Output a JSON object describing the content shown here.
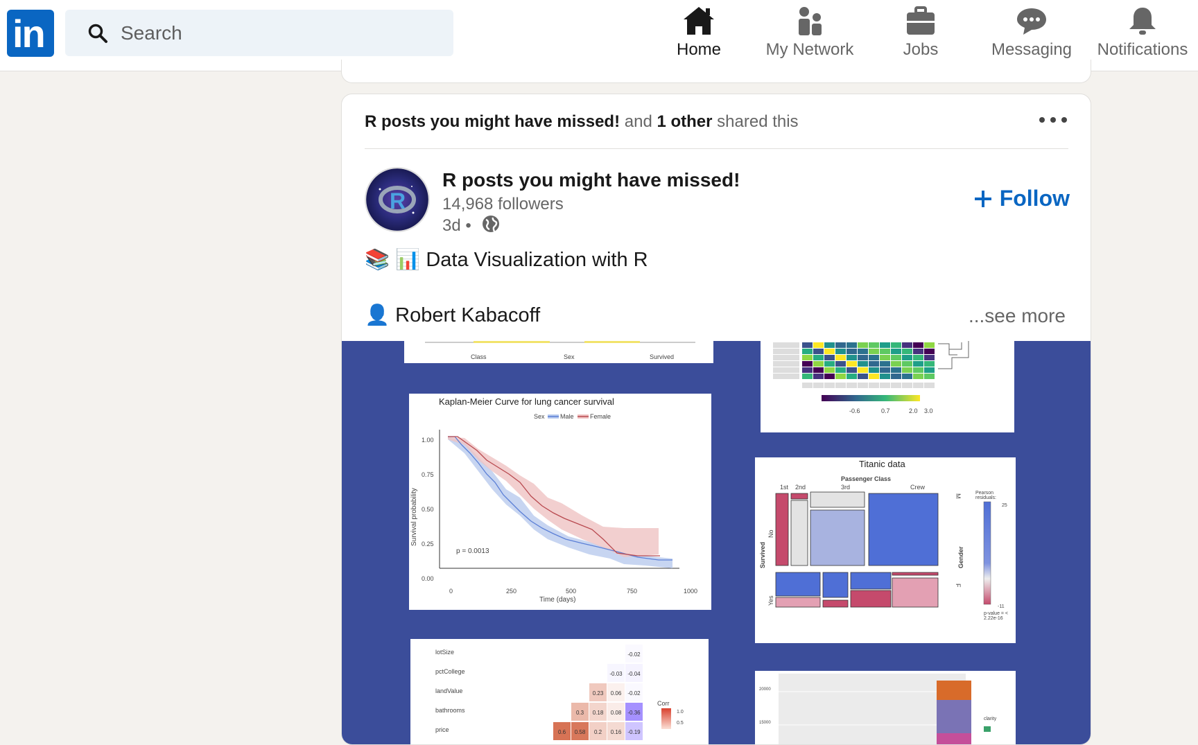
{
  "topbar": {
    "logo_text": "in",
    "search_placeholder": "Search",
    "nav": [
      {
        "label": "Home",
        "icon": "home-icon",
        "active": true
      },
      {
        "label": "My Network",
        "icon": "people-icon",
        "active": false
      },
      {
        "label": "Jobs",
        "icon": "briefcase-icon",
        "active": false
      },
      {
        "label": "Messaging",
        "icon": "chat-icon",
        "active": false
      },
      {
        "label": "Notifications",
        "icon": "bell-icon",
        "active": false
      }
    ]
  },
  "post": {
    "shared_by_1": "R posts you might have missed!",
    "shared_and": " and ",
    "shared_by_2": "1 other",
    "shared_suffix": " shared this",
    "page_name": "R posts you might have missed!",
    "followers": "14,968 followers",
    "time": "3d •",
    "follow_label": "Follow",
    "line1_emoji": "📚 📊",
    "line1_text": "Data Visualization with R",
    "line2_emoji": "👤",
    "line2_text": "Robert Kabacoff",
    "see_more": "...see more"
  },
  "media": {
    "km": {
      "title": "Kaplan-Meier Curve for lung cancer survival",
      "legend_strata": "Sex",
      "legend_male": "Male",
      "legend_female": "Female",
      "ylabel": "Survival probability",
      "xlabel": "Time (days)",
      "pvalue": "p = 0.0013",
      "yticks": [
        "1.00",
        "0.75",
        "0.50",
        "0.25",
        "0.00"
      ],
      "xticks": [
        "0",
        "250",
        "500",
        "750",
        "1000"
      ]
    },
    "titanic": {
      "title": "Titanic data",
      "class_label": "Passenger Class",
      "classes": [
        "1st",
        "2nd",
        "3rd",
        "Crew"
      ],
      "survived_label": "Survived",
      "survived_no": "No",
      "survived_yes": "Yes",
      "gender_label": "Gender",
      "gender_m": "M",
      "gender_f": "F",
      "legend_title": "Pearson residuals:",
      "legend_max": "25",
      "legend_min": "-11",
      "pvalue": "p-value = < 2.22e-16"
    },
    "heatmap": {
      "legend_ticks": [
        "-0.6",
        "0.7",
        "2.0",
        "3.0"
      ]
    },
    "corr": {
      "rows": [
        "lotSize",
        "pctCollege",
        "landValue",
        "bathrooms",
        "price"
      ],
      "values": [
        "-0.02",
        "-0.03",
        "-0.04",
        "0.23",
        "0.06",
        "-0.02",
        "0.3",
        "0.18",
        "0.08",
        "-0.36",
        "0.6",
        "0.58",
        "0.2",
        "0.16",
        "-0.19"
      ],
      "legend_title": "Corr",
      "legend_ticks": [
        "1.0",
        "0.5"
      ]
    },
    "bar": {
      "yticks": [
        "20000",
        "15000"
      ],
      "legend_title": "clarity"
    },
    "top_left_ticks": [
      "Class",
      "Sex",
      "Survived"
    ]
  }
}
